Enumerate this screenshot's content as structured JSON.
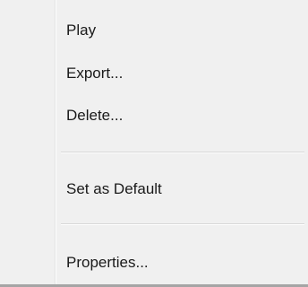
{
  "context_menu": {
    "items": [
      {
        "label": "Play"
      },
      {
        "label": "Export..."
      },
      {
        "label": "Delete..."
      },
      {
        "label": "Set as Default"
      },
      {
        "label": "Properties..."
      }
    ]
  }
}
